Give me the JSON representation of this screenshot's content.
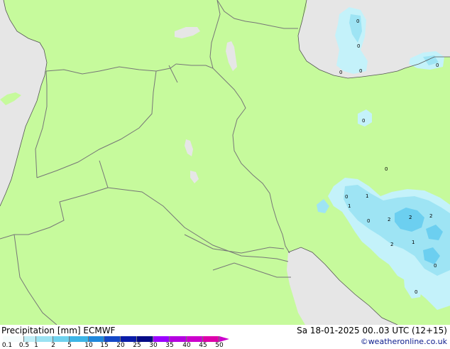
{
  "footer": {
    "title": "Precipitation [mm]  ECMWF",
    "datetime": "Sa 18-01-2025 00..03 UTC (12+15)",
    "copyright": "©weatheronline.co.uk"
  },
  "legend": {
    "ticks": [
      "0.1",
      "0.5",
      "1",
      "2",
      "5",
      "10",
      "15",
      "20",
      "25",
      "30",
      "35",
      "40",
      "45",
      "50"
    ],
    "colors": [
      "#f5fcfc",
      "#bfeef7",
      "#9be2f2",
      "#6fd2ee",
      "#3db5e6",
      "#1f87dc",
      "#1448c7",
      "#0a1ca8",
      "#060a86",
      "#9b00ff",
      "#b400e0",
      "#cc00cc",
      "#dd00aa"
    ]
  },
  "map": {
    "colors": {
      "land": "#c6fa9c",
      "land_outside": "#e6e6e6",
      "water": "#e6e6e6",
      "border": "#777777",
      "precip_light": "#c4f2fa",
      "precip_mid": "#9ee4f4",
      "precip_heavy": "#6ccff0"
    },
    "value_labels": [
      "0",
      "0",
      "0",
      "0",
      "0",
      "0",
      "0",
      "1",
      "0",
      "1",
      "0",
      "2",
      "2",
      "2",
      "2",
      "1",
      "0",
      "0"
    ]
  }
}
